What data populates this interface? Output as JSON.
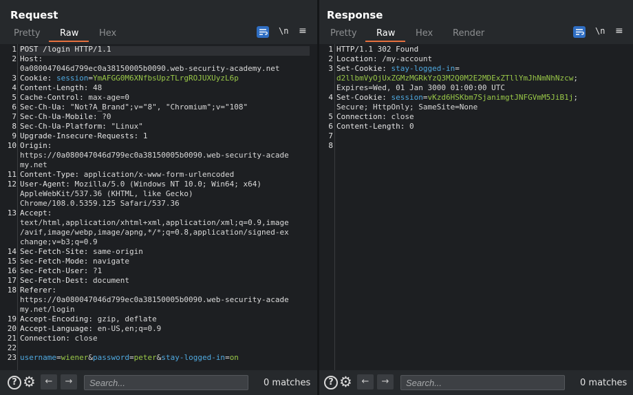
{
  "request": {
    "title": "Request",
    "tabs": [
      {
        "label": "Pretty"
      },
      {
        "label": "Raw",
        "active": true
      },
      {
        "label": "Hex"
      }
    ],
    "wrap_glyph": "\\n",
    "menu_glyph": "≡",
    "lines": [
      {
        "n": "1",
        "parts": [
          {
            "t": "POST /login HTTP/1.1",
            "c": "hdr"
          }
        ]
      },
      {
        "n": "2",
        "parts": [
          {
            "t": "Host:",
            "c": "hdr"
          }
        ]
      },
      {
        "n": "",
        "parts": [
          {
            "t": "0a080047046d799ec0a38150005b0090.web-security-academy.net",
            "c": "val"
          }
        ]
      },
      {
        "n": "3",
        "parts": [
          {
            "t": "Cookie: ",
            "c": "hdr"
          },
          {
            "t": "session",
            "c": "cyan"
          },
          {
            "t": "=",
            "c": "val"
          },
          {
            "t": "YmAFGG0M6XNfbsUpzTLrgROJUXUyzL6p",
            "c": "green"
          }
        ]
      },
      {
        "n": "4",
        "parts": [
          {
            "t": "Content-Length: ",
            "c": "hdr"
          },
          {
            "t": "48",
            "c": "val"
          }
        ]
      },
      {
        "n": "5",
        "parts": [
          {
            "t": "Cache-Control: ",
            "c": "hdr"
          },
          {
            "t": "max-age=0",
            "c": "val"
          }
        ]
      },
      {
        "n": "6",
        "parts": [
          {
            "t": "Sec-Ch-Ua: ",
            "c": "hdr"
          },
          {
            "t": "\"Not?A_Brand\";v=\"8\", \"Chromium\";v=\"108\"",
            "c": "val"
          }
        ]
      },
      {
        "n": "7",
        "parts": [
          {
            "t": "Sec-Ch-Ua-Mobile: ",
            "c": "hdr"
          },
          {
            "t": "?0",
            "c": "val"
          }
        ]
      },
      {
        "n": "8",
        "parts": [
          {
            "t": "Sec-Ch-Ua-Platform: ",
            "c": "hdr"
          },
          {
            "t": "\"Linux\"",
            "c": "val"
          }
        ]
      },
      {
        "n": "9",
        "parts": [
          {
            "t": "Upgrade-Insecure-Requests: ",
            "c": "hdr"
          },
          {
            "t": "1",
            "c": "val"
          }
        ]
      },
      {
        "n": "10",
        "parts": [
          {
            "t": "Origin:",
            "c": "hdr"
          }
        ]
      },
      {
        "n": "",
        "parts": [
          {
            "t": "https://0a080047046d799ec0a38150005b0090.web-security-acade",
            "c": "val"
          }
        ]
      },
      {
        "n": "",
        "parts": [
          {
            "t": "my.net",
            "c": "val"
          }
        ]
      },
      {
        "n": "11",
        "parts": [
          {
            "t": "Content-Type: ",
            "c": "hdr"
          },
          {
            "t": "application/x-www-form-urlencoded",
            "c": "val"
          }
        ]
      },
      {
        "n": "12",
        "parts": [
          {
            "t": "User-Agent: ",
            "c": "hdr"
          },
          {
            "t": "Mozilla/5.0 (Windows NT 10.0; Win64; x64)",
            "c": "val"
          }
        ]
      },
      {
        "n": "",
        "parts": [
          {
            "t": "AppleWebKit/537.36 (KHTML, like Gecko)",
            "c": "val"
          }
        ]
      },
      {
        "n": "",
        "parts": [
          {
            "t": "Chrome/108.0.5359.125 Safari/537.36",
            "c": "val"
          }
        ]
      },
      {
        "n": "13",
        "parts": [
          {
            "t": "Accept:",
            "c": "hdr"
          }
        ]
      },
      {
        "n": "",
        "parts": [
          {
            "t": "text/html,application/xhtml+xml,application/xml;q=0.9,image",
            "c": "val"
          }
        ]
      },
      {
        "n": "",
        "parts": [
          {
            "t": "/avif,image/webp,image/apng,*/*;q=0.8,application/signed-ex",
            "c": "val"
          }
        ]
      },
      {
        "n": "",
        "parts": [
          {
            "t": "change;v=b3;q=0.9",
            "c": "val"
          }
        ]
      },
      {
        "n": "14",
        "parts": [
          {
            "t": "Sec-Fetch-Site: ",
            "c": "hdr"
          },
          {
            "t": "same-origin",
            "c": "val"
          }
        ]
      },
      {
        "n": "15",
        "parts": [
          {
            "t": "Sec-Fetch-Mode: ",
            "c": "hdr"
          },
          {
            "t": "navigate",
            "c": "val"
          }
        ]
      },
      {
        "n": "16",
        "parts": [
          {
            "t": "Sec-Fetch-User: ",
            "c": "hdr"
          },
          {
            "t": "?1",
            "c": "val"
          }
        ]
      },
      {
        "n": "17",
        "parts": [
          {
            "t": "Sec-Fetch-Dest: ",
            "c": "hdr"
          },
          {
            "t": "document",
            "c": "val"
          }
        ]
      },
      {
        "n": "18",
        "parts": [
          {
            "t": "Referer:",
            "c": "hdr"
          }
        ]
      },
      {
        "n": "",
        "parts": [
          {
            "t": "https://0a080047046d799ec0a38150005b0090.web-security-acade",
            "c": "val"
          }
        ]
      },
      {
        "n": "",
        "parts": [
          {
            "t": "my.net/login",
            "c": "val"
          }
        ]
      },
      {
        "n": "19",
        "parts": [
          {
            "t": "Accept-Encoding: ",
            "c": "hdr"
          },
          {
            "t": "gzip, deflate",
            "c": "val"
          }
        ]
      },
      {
        "n": "20",
        "parts": [
          {
            "t": "Accept-Language: ",
            "c": "hdr"
          },
          {
            "t": "en-US,en;q=0.9",
            "c": "val"
          }
        ]
      },
      {
        "n": "21",
        "parts": [
          {
            "t": "Connection: ",
            "c": "hdr"
          },
          {
            "t": "close",
            "c": "val"
          }
        ]
      },
      {
        "n": "22",
        "parts": []
      },
      {
        "n": "23",
        "parts": [
          {
            "t": "username",
            "c": "cyan"
          },
          {
            "t": "=",
            "c": "val"
          },
          {
            "t": "wiener",
            "c": "green"
          },
          {
            "t": "&",
            "c": "val"
          },
          {
            "t": "password",
            "c": "cyan"
          },
          {
            "t": "=",
            "c": "val"
          },
          {
            "t": "peter",
            "c": "green"
          },
          {
            "t": "&",
            "c": "val"
          },
          {
            "t": "stay-logged-in",
            "c": "cyan"
          },
          {
            "t": "=",
            "c": "val"
          },
          {
            "t": "on",
            "c": "green"
          }
        ]
      }
    ],
    "search_placeholder": "Search...",
    "matches": "0 matches"
  },
  "response": {
    "title": "Response",
    "tabs": [
      {
        "label": "Pretty"
      },
      {
        "label": "Raw",
        "active": true
      },
      {
        "label": "Hex"
      },
      {
        "label": "Render"
      }
    ],
    "wrap_glyph": "\\n",
    "menu_glyph": "≡",
    "lines": [
      {
        "n": "1",
        "parts": [
          {
            "t": "HTTP/1.1 302 Found",
            "c": "hdr"
          }
        ]
      },
      {
        "n": "2",
        "parts": [
          {
            "t": "Location: ",
            "c": "hdr"
          },
          {
            "t": "/my-account",
            "c": "val"
          }
        ]
      },
      {
        "n": "3",
        "parts": [
          {
            "t": "Set-Cookie: ",
            "c": "hdr"
          },
          {
            "t": "stay-logged-in",
            "c": "cyan"
          },
          {
            "t": "=",
            "c": "val"
          }
        ]
      },
      {
        "n": "",
        "parts": [
          {
            "t": "d2llbmVyOjUxZGMzMGRkYzQ3M2Q0M2E2MDExZTllYmJhNmNhNzcw",
            "c": "green"
          },
          {
            "t": ";",
            "c": "val"
          }
        ]
      },
      {
        "n": "",
        "parts": [
          {
            "t": "Expires=Wed, 01 Jan 3000 01:00:00 UTC",
            "c": "val"
          }
        ]
      },
      {
        "n": "4",
        "parts": [
          {
            "t": "Set-Cookie: ",
            "c": "hdr"
          },
          {
            "t": "session",
            "c": "cyan"
          },
          {
            "t": "=",
            "c": "val"
          },
          {
            "t": "vKzd6HSKbm7SjanimgtJNFGVmM5JiB1j",
            "c": "green"
          },
          {
            "t": ";",
            "c": "val"
          }
        ]
      },
      {
        "n": "",
        "parts": [
          {
            "t": "Secure; HttpOnly; SameSite=None",
            "c": "val"
          }
        ]
      },
      {
        "n": "5",
        "parts": [
          {
            "t": "Connection: ",
            "c": "hdr"
          },
          {
            "t": "close",
            "c": "val"
          }
        ]
      },
      {
        "n": "6",
        "parts": [
          {
            "t": "Content-Length: ",
            "c": "hdr"
          },
          {
            "t": "0",
            "c": "val"
          }
        ]
      },
      {
        "n": "7",
        "parts": []
      },
      {
        "n": "8",
        "parts": []
      }
    ],
    "search_placeholder": "Search...",
    "matches": "0 matches"
  },
  "bottom_bar": {
    "help_glyph": "?",
    "settings_glyph": "⚙",
    "prev_glyph": "←",
    "next_glyph": "→"
  },
  "colors": {
    "accent_orange": "#e8713e",
    "accent_blue": "#2f6ec3",
    "value_green": "#99c848",
    "name_cyan": "#4fa9e0"
  }
}
